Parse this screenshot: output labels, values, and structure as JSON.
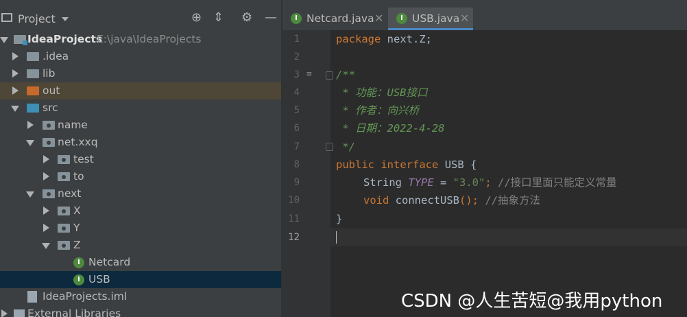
{
  "project_panel": {
    "title": "Project",
    "tree": [
      {
        "label": "IdeaProjects",
        "path": "E:\\java\\IdeaProjects",
        "type": "root",
        "expanded": true
      },
      {
        "label": ".idea",
        "type": "folder",
        "expanded": false
      },
      {
        "label": "lib",
        "type": "folder",
        "expanded": false
      },
      {
        "label": "out",
        "type": "folder-excluded",
        "expanded": false
      },
      {
        "label": "src",
        "type": "folder-source",
        "expanded": true
      },
      {
        "label": "name",
        "type": "package",
        "expanded": false
      },
      {
        "label": "net.xxq",
        "type": "package",
        "expanded": true
      },
      {
        "label": "test",
        "type": "package",
        "expanded": false
      },
      {
        "label": "to",
        "type": "package",
        "expanded": false
      },
      {
        "label": "next",
        "type": "package",
        "expanded": true
      },
      {
        "label": "X",
        "type": "package",
        "expanded": false
      },
      {
        "label": "Y",
        "type": "package",
        "expanded": false
      },
      {
        "label": "Z",
        "type": "package",
        "expanded": true
      },
      {
        "label": "Netcard",
        "type": "interface"
      },
      {
        "label": "USB",
        "type": "interface",
        "selected": true
      },
      {
        "label": "IdeaProjects.iml",
        "type": "file"
      },
      {
        "label": "External Libraries",
        "type": "library"
      }
    ]
  },
  "tabs": [
    {
      "label": "Netcard.java",
      "icon": "interface-icon",
      "active": false
    },
    {
      "label": "USB.java",
      "icon": "interface-icon",
      "active": true
    }
  ],
  "editor": {
    "line_numbers": [
      "1",
      "2",
      "3",
      "4",
      "5",
      "6",
      "7",
      "8",
      "9",
      "10",
      "11",
      "12"
    ],
    "current_line": "12",
    "code": {
      "l1_kw": "package",
      "l1_rest": " next.Z;",
      "l3": "/**",
      "l4": " * 功能：USB接口",
      "l5": " * 作者：向兴桥",
      "l6": " * 日期：2022-4-28",
      "l7": " */",
      "l8_kw1": "public",
      "l8_kw2": "interface",
      "l8_name": "USB",
      "l8_brace": " {",
      "l9_type": "String",
      "l9_const": "TYPE",
      "l9_eq": " = ",
      "l9_str": "\"3.0\"",
      "l9_semi": ";",
      "l9_cmt": " //接口里面只能定义常量",
      "l10_kw": "void",
      "l10_fn": "connectUSB",
      "l10_rest": "();",
      "l10_cmt": " //抽象方法",
      "l11": "}"
    }
  },
  "watermark": "CSDN @人生苦短@我用python",
  "colors": {
    "keyword": "#cc7832",
    "doc_comment": "#629755",
    "string": "#6a8759",
    "constant": "#9876aa",
    "comment": "#808080",
    "selection": "#0d293e"
  }
}
